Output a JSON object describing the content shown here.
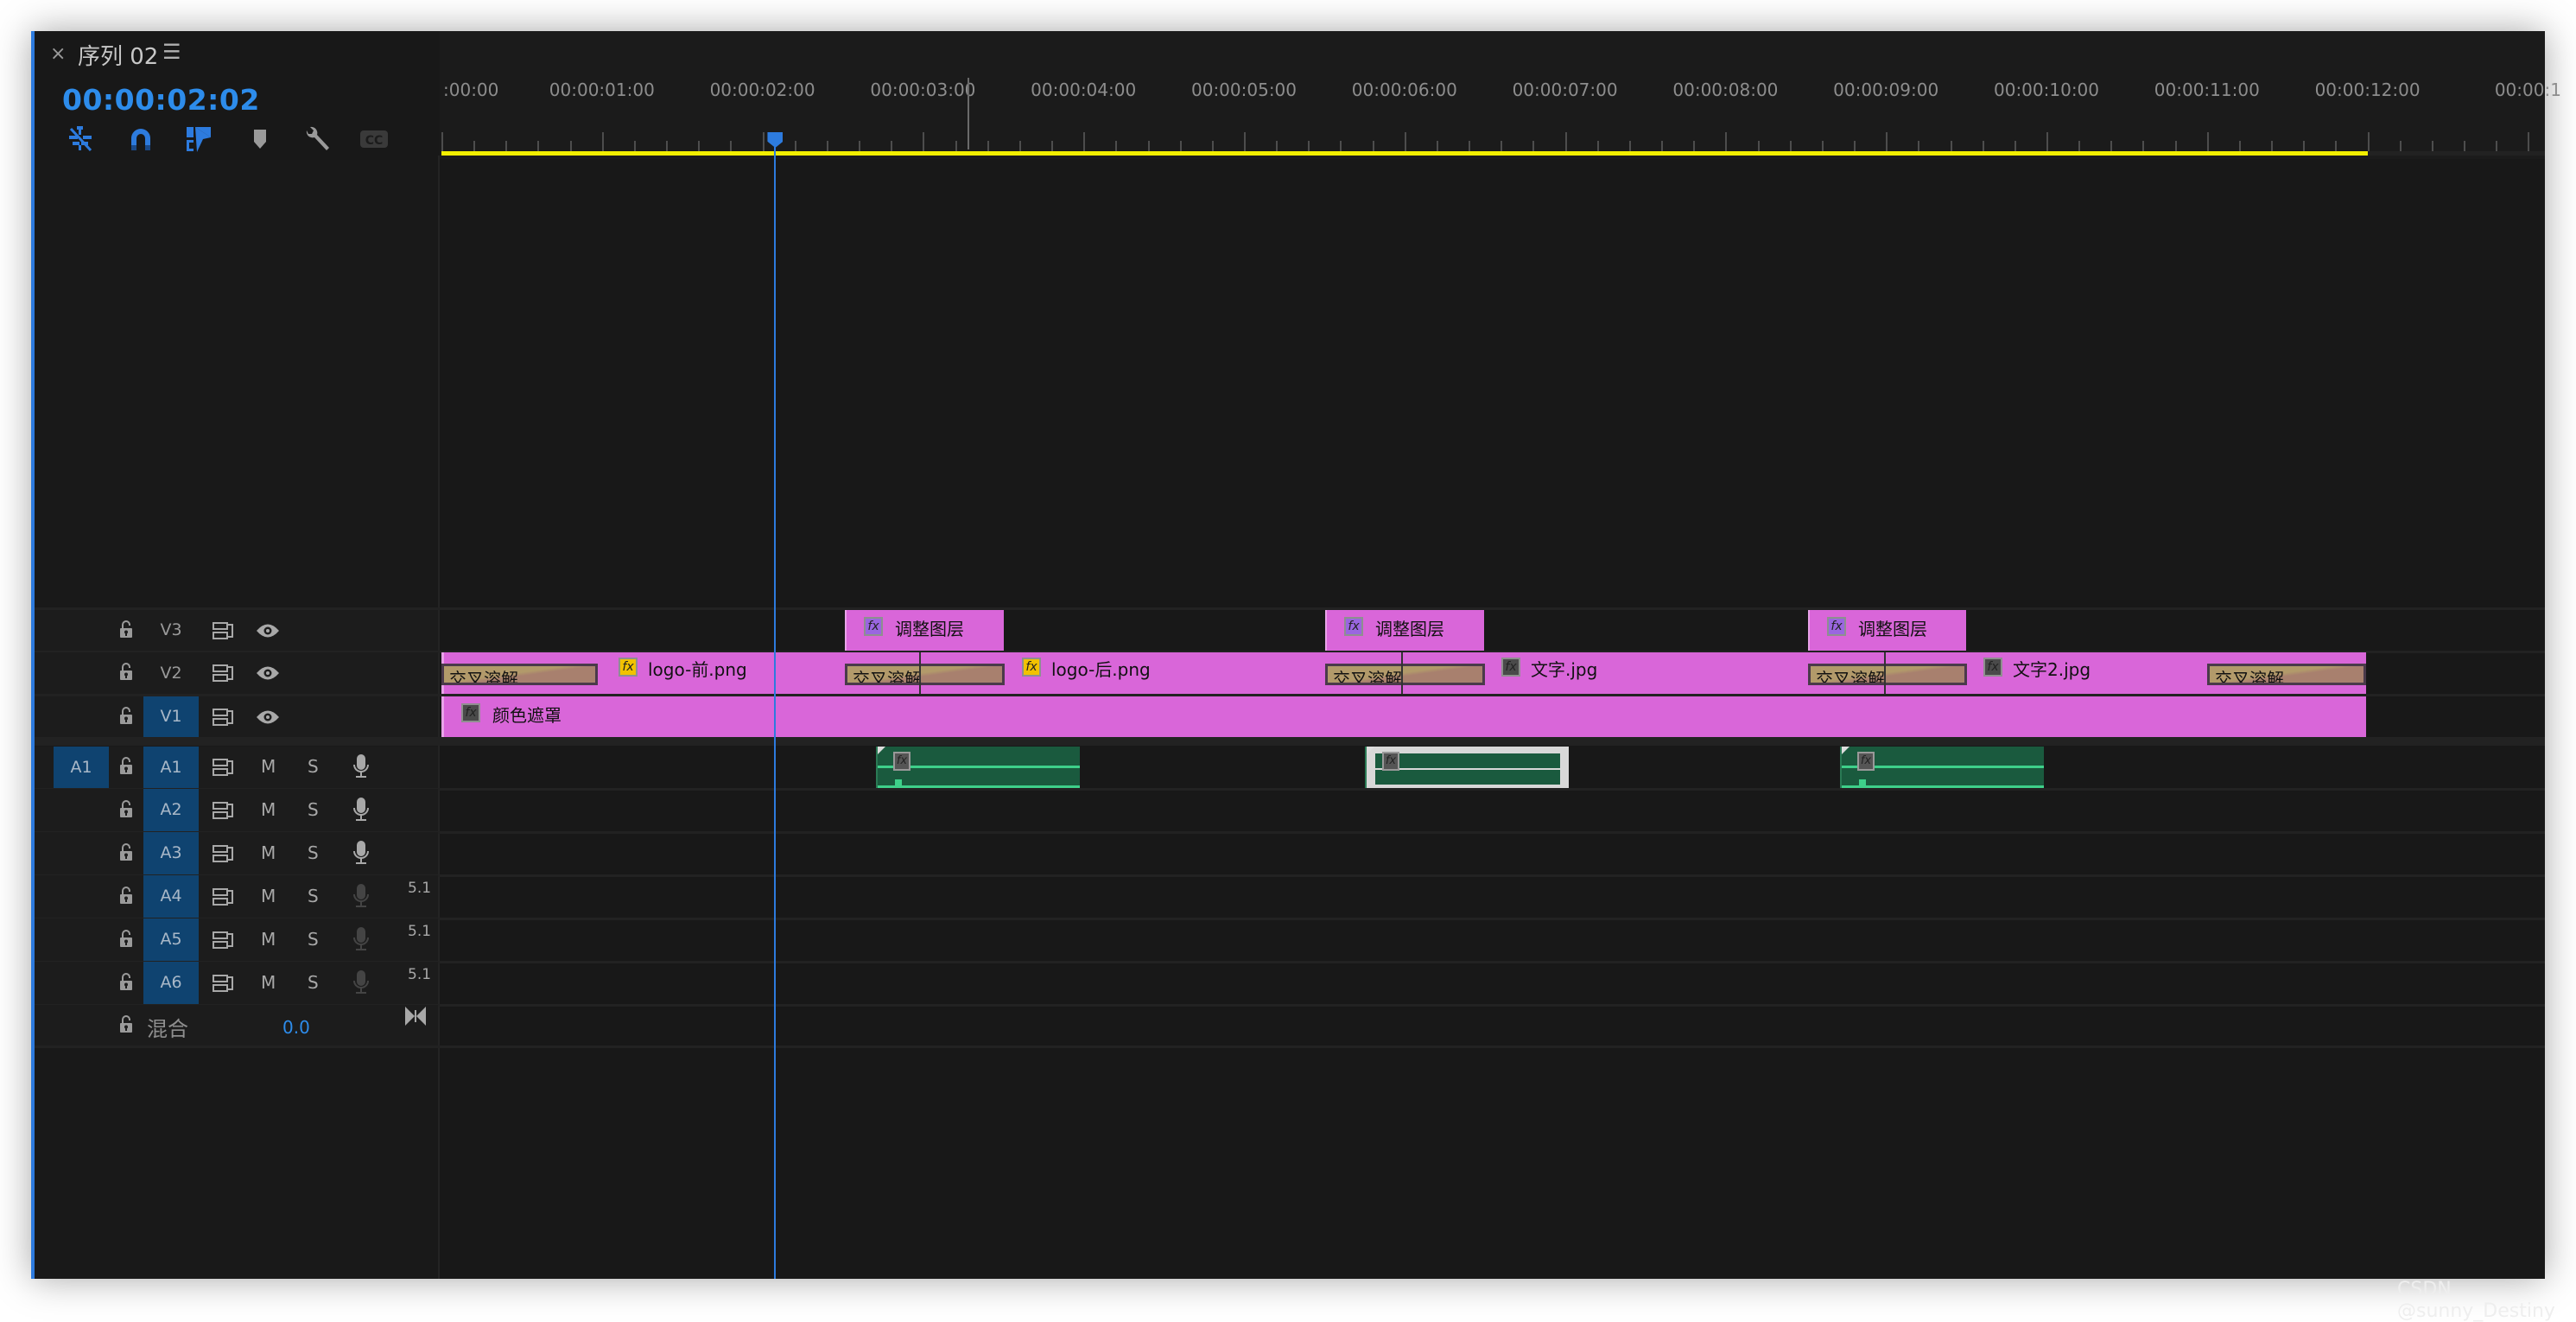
{
  "panel": {
    "close_glyph": "×",
    "title": "序列 02",
    "menu_glyph": "☰",
    "timecode": "00:00:02:02",
    "toolbar": [
      {
        "name": "snap-nest-icon",
        "label": "Insert or overwrite sequences as nests"
      },
      {
        "name": "snap-magnet-icon",
        "label": "Snap"
      },
      {
        "name": "linked-selection-icon",
        "label": "Linked Selection"
      },
      {
        "name": "add-marker-icon",
        "label": "Add Marker"
      },
      {
        "name": "wrench-icon",
        "label": "Timeline Display Settings"
      },
      {
        "name": "captions-icon",
        "label": "CC"
      }
    ]
  },
  "ruler": {
    "labels": [
      ":00:00",
      "00:00:01:00",
      "00:00:02:00",
      "00:00:03:00",
      "00:00:04:00",
      "00:00:05:00",
      "00:00:06:00",
      "00:00:07:00",
      "00:00:08:00",
      "00:00:09:00",
      "00:00:10:00",
      "00:00:11:00",
      "00:00:12:00",
      "00:00:1"
    ],
    "work_area_end_seconds": 12,
    "playhead_seconds": 2.08
  },
  "tracks": {
    "video": [
      {
        "label": "V3",
        "targeted": false
      },
      {
        "label": "V2",
        "targeted": false
      },
      {
        "label": "V1",
        "targeted": true
      }
    ],
    "audio": [
      {
        "source": "A1",
        "label": "A1",
        "mute": "M",
        "solo": "S",
        "channel": ""
      },
      {
        "source": "",
        "label": "A2",
        "mute": "M",
        "solo": "S",
        "channel": ""
      },
      {
        "source": "",
        "label": "A3",
        "mute": "M",
        "solo": "S",
        "channel": ""
      },
      {
        "source": "",
        "label": "A4",
        "mute": "M",
        "solo": "S",
        "channel": "5.1"
      },
      {
        "source": "",
        "label": "A5",
        "mute": "M",
        "solo": "S",
        "channel": "5.1"
      },
      {
        "source": "",
        "label": "A6",
        "mute": "M",
        "solo": "S",
        "channel": "5.1"
      }
    ],
    "mix": {
      "label": "混合",
      "value": "0.0"
    }
  },
  "clips": {
    "v3": [
      {
        "name": "调整图层",
        "fx": "purple"
      },
      {
        "name": "调整图层",
        "fx": "purple"
      },
      {
        "name": "调整图层",
        "fx": "purple"
      }
    ],
    "v2": [
      {
        "name": "logo-前.png",
        "fx": "yellow"
      },
      {
        "name": "logo-后.png",
        "fx": "yellow"
      },
      {
        "name": "文字.jpg",
        "fx": "dark"
      },
      {
        "name": "文字2.jpg",
        "fx": "dark"
      }
    ],
    "v2_transitions": [
      "交叉溶解",
      "交叉溶解",
      "交叉溶解",
      "交叉溶解",
      "交叉溶解"
    ],
    "v1": [
      {
        "name": "颜色遮罩",
        "fx": "dark"
      }
    ],
    "a1": [
      {
        "selected": false
      },
      {
        "selected": true
      },
      {
        "selected": false
      }
    ],
    "fx_glyph": "fx"
  },
  "colors": {
    "accent": "#2d8ceb",
    "clip_video": "#d966d9",
    "clip_audio": "#1a5a3e",
    "work_area": "#f2ef00",
    "track_target": "#0f4370"
  },
  "watermark": "CSDN @sunny_Destiny"
}
